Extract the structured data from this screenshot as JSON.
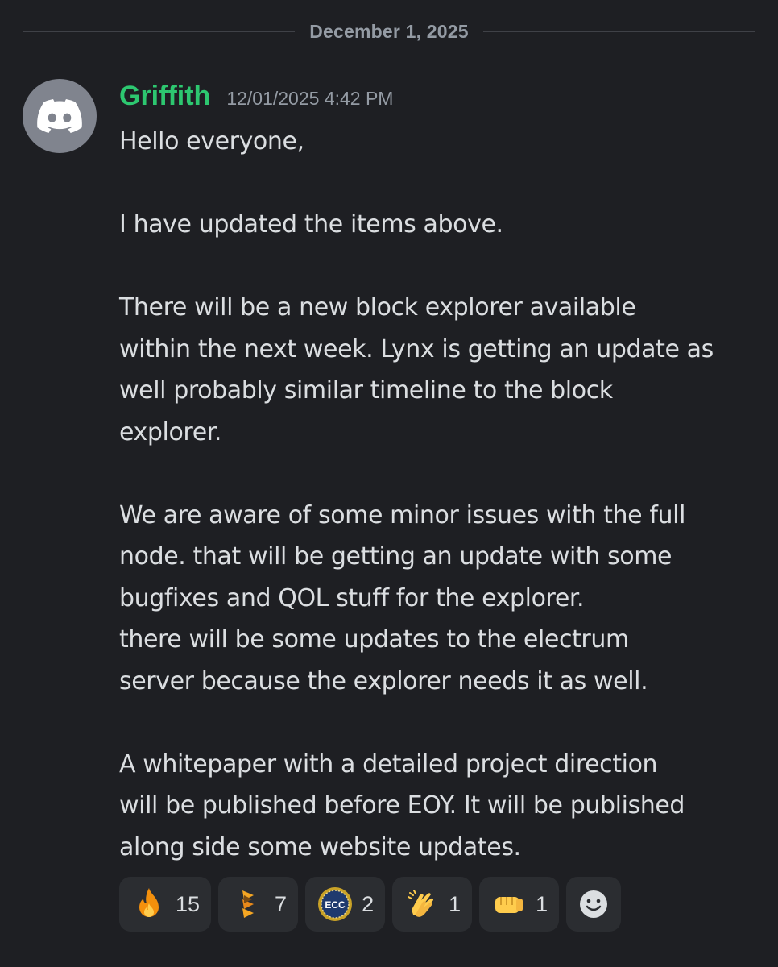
{
  "divider": {
    "date": "December 1, 2025"
  },
  "message": {
    "avatar_icon": "discord-logo-icon",
    "username": "Griffith",
    "username_color": "#2dc770",
    "timestamp": "12/01/2025 4:42 PM",
    "lines": [
      "Hello everyone,",
      "",
      "I have updated the items above.",
      "",
      "There will be a new block explorer available",
      "within the next week. Lynx is getting an update as",
      "well probably similar timeline to the block",
      "explorer.",
      "",
      "We are aware of some minor issues with the full",
      "node. that will be getting an update with some",
      "bugfixes and QOL stuff for the explorer.",
      "there will be some updates to the electrum",
      "server because the explorer needs it as well.",
      "",
      "A whitepaper with a detailed project direction",
      "will be published before EOY. It will be published",
      "along side some website updates."
    ]
  },
  "reactions": [
    {
      "icon": "fire-icon",
      "count": "15"
    },
    {
      "icon": "stacked-chevron-logo-icon",
      "count": "7"
    },
    {
      "icon": "ecc-coin-icon",
      "count": "2"
    },
    {
      "icon": "clapping-hands-icon",
      "count": "1"
    },
    {
      "icon": "fist-bump-icon",
      "count": "1"
    }
  ],
  "add_reaction_icon": "add-reaction-smiley-icon"
}
